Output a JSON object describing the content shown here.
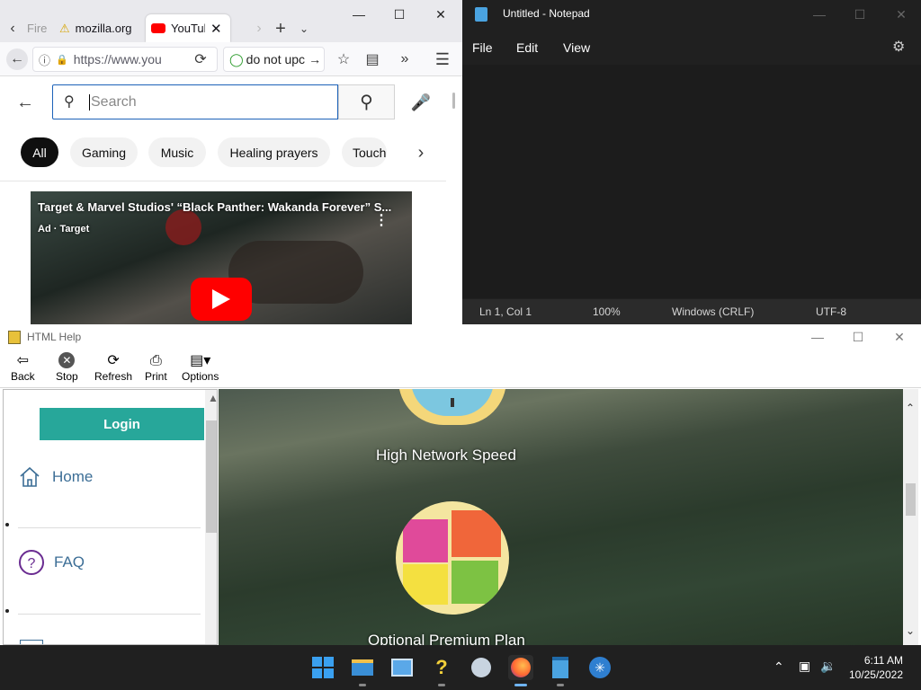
{
  "firefox": {
    "tabs": [
      {
        "label": "Fire"
      },
      {
        "label": "mozilla.org"
      },
      {
        "label": "YouTube"
      }
    ],
    "url": "https://www.you",
    "search_box": "do not upc",
    "youtube": {
      "search_placeholder": "Search",
      "chips": [
        "All",
        "Gaming",
        "Music",
        "Healing prayers",
        "Touch"
      ],
      "ad_title": "Target & Marvel Studios' “Black Panther: Wakanda Forever” S...",
      "ad_label": "Ad · Target"
    }
  },
  "notepad": {
    "title": "Untitled - Notepad",
    "menu": [
      "File",
      "Edit",
      "View"
    ],
    "status": {
      "position": "Ln 1, Col 1",
      "zoom": "100%",
      "line_ending": "Windows (CRLF)",
      "encoding": "UTF-8"
    }
  },
  "html_help": {
    "title": "HTML Help",
    "toolbar": [
      {
        "label": "Back",
        "icon": "back-arrow-icon"
      },
      {
        "label": "Stop",
        "icon": "stop-icon"
      },
      {
        "label": "Refresh",
        "icon": "refresh-icon"
      },
      {
        "label": "Print",
        "icon": "print-icon"
      },
      {
        "label": "Options",
        "icon": "options-icon"
      }
    ],
    "nav": {
      "login": "Login",
      "items": [
        {
          "label": "Home",
          "icon": "home-icon"
        },
        {
          "label": "FAQ",
          "icon": "question-icon"
        }
      ]
    },
    "content": {
      "feature_1": "High Network Speed",
      "feature_2": "Optional Premium Plan"
    }
  },
  "taskbar": {
    "time": "6:11 AM",
    "date": "10/25/2022"
  },
  "colors": {
    "login_button": "#27a79a",
    "youtube_red": "#ff0000",
    "notepad_bg": "#202020"
  }
}
